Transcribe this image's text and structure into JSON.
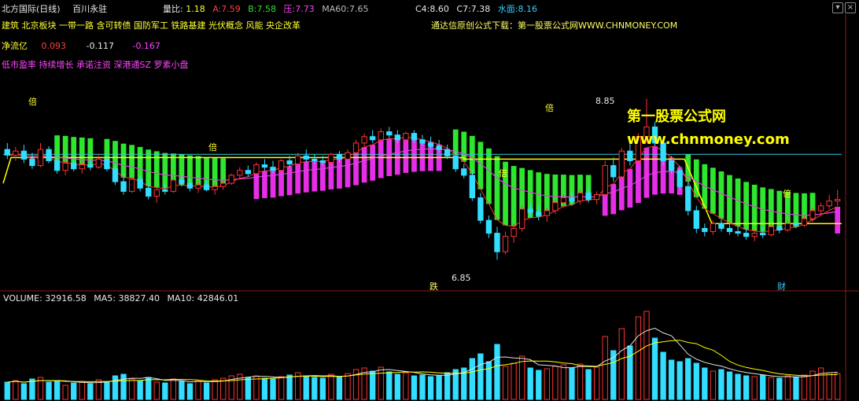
{
  "header": {
    "title": "北方国际(日线)",
    "indicator_name": "百川永驻",
    "liangbi_label": "量比:",
    "liangbi_value": "1.18",
    "a_label": "A:",
    "a_value": "7.59",
    "b_label": "B:",
    "b_value": "7.58",
    "ya_label": "压:",
    "ya_value": "7.73",
    "ma60_label": "MA60:",
    "ma60_value": "7.65",
    "c4_label": "C4:",
    "c4_value": "8.60",
    "c7_label": "C7:",
    "c7_value": "7.38",
    "shuimian_label": "水面:",
    "shuimian_value": "8.16"
  },
  "concepts": [
    "建筑",
    "北京板块",
    "一带一路",
    "含可转债",
    "国防军工",
    "铁路基建",
    "光伏概念",
    "风能",
    "央企改革"
  ],
  "net_flow": {
    "label": "净流亿",
    "v1": "0.093",
    "v2": "-0.117",
    "v3": "-0.167"
  },
  "tags_row2": [
    "低市盈率",
    "持续增长",
    "承诺注资",
    "深港通SZ",
    "罗素小盘"
  ],
  "promo_text": "通达信原创公式下载：第一股票公式网WWW.CHNMONEY.COM",
  "watermark": {
    "cn": "第一股票公式网",
    "url": "www.chnmoney.com"
  },
  "markers": {
    "bei": "倍",
    "die": "跌",
    "cai": "财",
    "high_label": "8.85",
    "low_label": "6.85"
  },
  "volume_header": {
    "volume_label": "VOLUME:",
    "volume_value": "32916.58",
    "ma5_label": "MA5:",
    "ma5_value": "38827.40",
    "ma10_label": "MA10:",
    "ma10_value": "42846.01"
  },
  "colors": {
    "background": "#000000",
    "up": "#ff3333",
    "down": "#33ddff",
    "green_bar": "#33ff33",
    "magenta_bar": "#ff33ff",
    "yellow": "#ffff00",
    "white_line": "#e0e0e0",
    "magenta_line": "#dd44dd",
    "cyan_line": "#33ccdd"
  },
  "chart_data": {
    "type": "candlestick",
    "ylim": [
      6.6,
      9.1
    ],
    "price_reference_lines": {
      "shuimian": 8.16,
      "ma60": 7.65
    },
    "candles": [
      {
        "o": 8.22,
        "h": 8.3,
        "l": 8.1,
        "c": 8.15
      },
      {
        "o": 8.15,
        "h": 8.25,
        "l": 8.08,
        "c": 8.2
      },
      {
        "o": 8.2,
        "h": 8.28,
        "l": 8.05,
        "c": 8.1
      },
      {
        "o": 8.1,
        "h": 8.18,
        "l": 7.98,
        "c": 8.02
      },
      {
        "o": 8.02,
        "h": 8.3,
        "l": 8.0,
        "c": 8.22
      },
      {
        "o": 8.22,
        "h": 8.26,
        "l": 8.05,
        "c": 8.08
      },
      {
        "o": 8.08,
        "h": 8.12,
        "l": 7.92,
        "c": 7.96
      },
      {
        "o": 7.96,
        "h": 8.1,
        "l": 7.9,
        "c": 8.05
      },
      {
        "o": 8.05,
        "h": 8.12,
        "l": 7.95,
        "c": 7.98
      },
      {
        "o": 7.98,
        "h": 8.08,
        "l": 7.92,
        "c": 8.03
      },
      {
        "o": 8.03,
        "h": 8.1,
        "l": 7.96,
        "c": 8.0
      },
      {
        "o": 8.0,
        "h": 8.15,
        "l": 7.98,
        "c": 8.1
      },
      {
        "o": 8.1,
        "h": 8.14,
        "l": 7.95,
        "c": 7.98
      },
      {
        "o": 7.98,
        "h": 8.02,
        "l": 7.78,
        "c": 7.82
      },
      {
        "o": 7.82,
        "h": 7.92,
        "l": 7.66,
        "c": 7.7
      },
      {
        "o": 7.7,
        "h": 7.88,
        "l": 7.68,
        "c": 7.85
      },
      {
        "o": 7.85,
        "h": 7.9,
        "l": 7.7,
        "c": 7.74
      },
      {
        "o": 7.74,
        "h": 7.8,
        "l": 7.6,
        "c": 7.64
      },
      {
        "o": 7.64,
        "h": 7.76,
        "l": 7.56,
        "c": 7.72
      },
      {
        "o": 7.72,
        "h": 7.8,
        "l": 7.66,
        "c": 7.7
      },
      {
        "o": 7.7,
        "h": 7.88,
        "l": 7.68,
        "c": 7.84
      },
      {
        "o": 7.84,
        "h": 7.9,
        "l": 7.76,
        "c": 7.8
      },
      {
        "o": 7.8,
        "h": 7.86,
        "l": 7.7,
        "c": 7.74
      },
      {
        "o": 7.74,
        "h": 7.82,
        "l": 7.68,
        "c": 7.78
      },
      {
        "o": 7.78,
        "h": 7.84,
        "l": 7.7,
        "c": 7.72
      },
      {
        "o": 7.72,
        "h": 7.8,
        "l": 7.66,
        "c": 7.76
      },
      {
        "o": 7.76,
        "h": 7.84,
        "l": 7.72,
        "c": 7.8
      },
      {
        "o": 7.8,
        "h": 7.92,
        "l": 7.78,
        "c": 7.9
      },
      {
        "o": 7.9,
        "h": 8.0,
        "l": 7.86,
        "c": 7.96
      },
      {
        "o": 7.96,
        "h": 8.02,
        "l": 7.88,
        "c": 7.92
      },
      {
        "o": 7.92,
        "h": 8.06,
        "l": 7.9,
        "c": 8.03
      },
      {
        "o": 8.03,
        "h": 8.1,
        "l": 7.96,
        "c": 8.0
      },
      {
        "o": 8.0,
        "h": 8.08,
        "l": 7.92,
        "c": 7.96
      },
      {
        "o": 7.96,
        "h": 8.1,
        "l": 7.94,
        "c": 8.08
      },
      {
        "o": 8.08,
        "h": 8.14,
        "l": 8.0,
        "c": 8.04
      },
      {
        "o": 8.04,
        "h": 8.18,
        "l": 8.02,
        "c": 8.14
      },
      {
        "o": 8.14,
        "h": 8.22,
        "l": 8.06,
        "c": 8.1
      },
      {
        "o": 8.1,
        "h": 8.16,
        "l": 8.04,
        "c": 8.08
      },
      {
        "o": 8.08,
        "h": 8.14,
        "l": 8.02,
        "c": 8.06
      },
      {
        "o": 8.06,
        "h": 8.18,
        "l": 8.04,
        "c": 8.16
      },
      {
        "o": 8.16,
        "h": 8.2,
        "l": 8.06,
        "c": 8.1
      },
      {
        "o": 8.1,
        "h": 8.22,
        "l": 8.08,
        "c": 8.18
      },
      {
        "o": 8.18,
        "h": 8.34,
        "l": 8.16,
        "c": 8.3
      },
      {
        "o": 8.3,
        "h": 8.42,
        "l": 8.26,
        "c": 8.38
      },
      {
        "o": 8.38,
        "h": 8.46,
        "l": 8.3,
        "c": 8.34
      },
      {
        "o": 8.34,
        "h": 8.48,
        "l": 8.32,
        "c": 8.44
      },
      {
        "o": 8.44,
        "h": 8.5,
        "l": 8.36,
        "c": 8.4
      },
      {
        "o": 8.4,
        "h": 8.46,
        "l": 8.3,
        "c": 8.34
      },
      {
        "o": 8.34,
        "h": 8.44,
        "l": 8.32,
        "c": 8.42
      },
      {
        "o": 8.42,
        "h": 8.46,
        "l": 8.3,
        "c": 8.34
      },
      {
        "o": 8.34,
        "h": 8.4,
        "l": 8.26,
        "c": 8.3
      },
      {
        "o": 8.3,
        "h": 8.38,
        "l": 8.22,
        "c": 8.26
      },
      {
        "o": 8.26,
        "h": 8.34,
        "l": 8.18,
        "c": 8.22
      },
      {
        "o": 8.22,
        "h": 8.28,
        "l": 8.1,
        "c": 8.14
      },
      {
        "o": 8.14,
        "h": 8.2,
        "l": 7.94,
        "c": 7.98
      },
      {
        "o": 7.98,
        "h": 8.04,
        "l": 7.86,
        "c": 7.9
      },
      {
        "o": 7.9,
        "h": 7.96,
        "l": 7.58,
        "c": 7.62
      },
      {
        "o": 7.62,
        "h": 7.68,
        "l": 7.3,
        "c": 7.34
      },
      {
        "o": 7.34,
        "h": 7.4,
        "l": 7.12,
        "c": 7.18
      },
      {
        "o": 7.18,
        "h": 7.26,
        "l": 6.85,
        "c": 6.95
      },
      {
        "o": 6.95,
        "h": 7.2,
        "l": 6.92,
        "c": 7.14
      },
      {
        "o": 7.14,
        "h": 7.3,
        "l": 7.06,
        "c": 7.24
      },
      {
        "o": 7.24,
        "h": 7.52,
        "l": 7.2,
        "c": 7.48
      },
      {
        "o": 7.48,
        "h": 7.56,
        "l": 7.38,
        "c": 7.44
      },
      {
        "o": 7.44,
        "h": 7.52,
        "l": 7.34,
        "c": 7.4
      },
      {
        "o": 7.4,
        "h": 7.5,
        "l": 7.32,
        "c": 7.46
      },
      {
        "o": 7.46,
        "h": 7.6,
        "l": 7.42,
        "c": 7.56
      },
      {
        "o": 7.56,
        "h": 7.66,
        "l": 7.5,
        "c": 7.62
      },
      {
        "o": 7.62,
        "h": 7.7,
        "l": 7.52,
        "c": 7.58
      },
      {
        "o": 7.58,
        "h": 7.72,
        "l": 7.54,
        "c": 7.68
      },
      {
        "o": 7.68,
        "h": 7.74,
        "l": 7.56,
        "c": 7.6
      },
      {
        "o": 7.6,
        "h": 7.7,
        "l": 7.54,
        "c": 7.66
      },
      {
        "o": 7.66,
        "h": 8.08,
        "l": 7.64,
        "c": 8.02
      },
      {
        "o": 8.02,
        "h": 8.12,
        "l": 7.82,
        "c": 7.88
      },
      {
        "o": 7.88,
        "h": 8.24,
        "l": 7.84,
        "c": 8.2
      },
      {
        "o": 8.2,
        "h": 8.3,
        "l": 8.02,
        "c": 8.08
      },
      {
        "o": 8.08,
        "h": 8.42,
        "l": 8.06,
        "c": 8.38
      },
      {
        "o": 8.38,
        "h": 8.85,
        "l": 8.3,
        "c": 8.5
      },
      {
        "o": 8.5,
        "h": 8.56,
        "l": 8.26,
        "c": 8.3
      },
      {
        "o": 8.3,
        "h": 8.34,
        "l": 8.02,
        "c": 8.08
      },
      {
        "o": 8.08,
        "h": 8.14,
        "l": 7.92,
        "c": 7.96
      },
      {
        "o": 7.96,
        "h": 8.02,
        "l": 7.72,
        "c": 7.76
      },
      {
        "o": 7.76,
        "h": 7.82,
        "l": 7.4,
        "c": 7.46
      },
      {
        "o": 7.46,
        "h": 7.52,
        "l": 7.18,
        "c": 7.24
      },
      {
        "o": 7.24,
        "h": 7.3,
        "l": 7.14,
        "c": 7.2
      },
      {
        "o": 7.2,
        "h": 7.34,
        "l": 7.16,
        "c": 7.3
      },
      {
        "o": 7.3,
        "h": 7.36,
        "l": 7.2,
        "c": 7.24
      },
      {
        "o": 7.24,
        "h": 7.3,
        "l": 7.16,
        "c": 7.2
      },
      {
        "o": 7.2,
        "h": 7.28,
        "l": 7.14,
        "c": 7.18
      },
      {
        "o": 7.18,
        "h": 7.24,
        "l": 7.1,
        "c": 7.14
      },
      {
        "o": 7.14,
        "h": 7.22,
        "l": 7.08,
        "c": 7.18
      },
      {
        "o": 7.18,
        "h": 7.26,
        "l": 7.12,
        "c": 7.16
      },
      {
        "o": 7.16,
        "h": 7.3,
        "l": 7.14,
        "c": 7.26
      },
      {
        "o": 7.26,
        "h": 7.32,
        "l": 7.18,
        "c": 7.22
      },
      {
        "o": 7.22,
        "h": 7.34,
        "l": 7.2,
        "c": 7.3
      },
      {
        "o": 7.3,
        "h": 7.38,
        "l": 7.24,
        "c": 7.28
      },
      {
        "o": 7.28,
        "h": 7.4,
        "l": 7.26,
        "c": 7.36
      },
      {
        "o": 7.36,
        "h": 7.5,
        "l": 7.32,
        "c": 7.46
      },
      {
        "o": 7.46,
        "h": 7.56,
        "l": 7.4,
        "c": 7.52
      },
      {
        "o": 7.52,
        "h": 7.66,
        "l": 7.48,
        "c": 7.58
      },
      {
        "o": 7.58,
        "h": 7.72,
        "l": 7.52,
        "c": 7.6
      }
    ],
    "volume": {
      "ylim": [
        0,
        120000
      ],
      "values": [
        22000,
        24000,
        20000,
        26000,
        28000,
        22000,
        24000,
        18000,
        21000,
        23000,
        20000,
        25000,
        22000,
        30000,
        32000,
        26000,
        24000,
        28000,
        22000,
        21000,
        26000,
        23000,
        20000,
        24000,
        21000,
        25000,
        27000,
        30000,
        32000,
        28000,
        30000,
        27000,
        26000,
        29000,
        31000,
        34000,
        30000,
        28000,
        27000,
        32000,
        29000,
        33000,
        38000,
        40000,
        36000,
        41000,
        35000,
        32000,
        34000,
        30000,
        31000,
        29000,
        30000,
        34000,
        38000,
        40000,
        52000,
        58000,
        48000,
        70000,
        42000,
        46000,
        55000,
        40000,
        37000,
        39000,
        42000,
        44000,
        40000,
        45000,
        38000,
        41000,
        80000,
        62000,
        90000,
        68000,
        105000,
        112000,
        78000,
        60000,
        50000,
        48000,
        52000,
        46000,
        40000,
        36000,
        38000,
        35000,
        32000,
        30000,
        29000,
        31000,
        28000,
        27000,
        30000,
        28000,
        31000,
        36000,
        40000,
        34000,
        33000
      ]
    }
  }
}
